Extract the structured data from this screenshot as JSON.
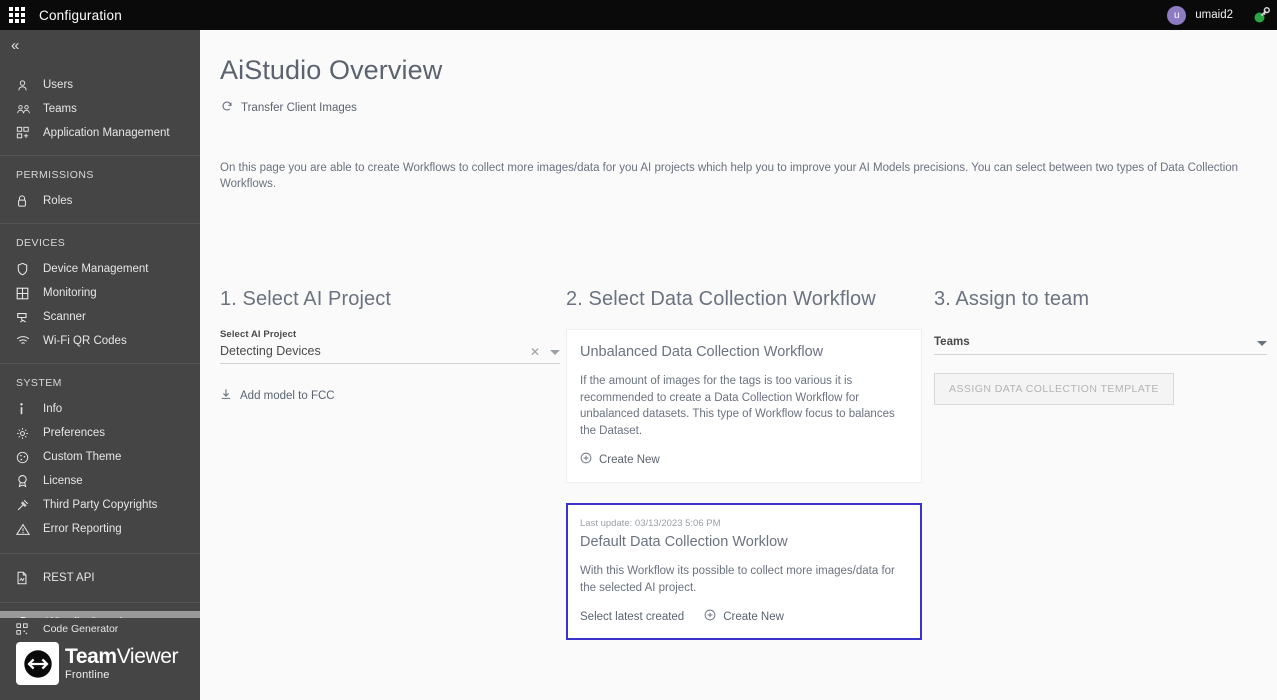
{
  "topbar": {
    "app_grid_icon": "app-grid-icon",
    "title": "Configuration",
    "user": {
      "initial": "u",
      "name": "umaid2"
    },
    "connection_icon": "plug-connected-icon"
  },
  "sidebar": {
    "collapse_icon": "chevron-double-left-icon",
    "groups": [
      {
        "label": "",
        "items": [
          {
            "icon": "user-icon",
            "label": "Users",
            "selected": false
          },
          {
            "icon": "users-group-icon",
            "label": "Teams",
            "selected": false
          },
          {
            "icon": "application-management-icon",
            "label": "Application Management",
            "selected": false
          }
        ]
      },
      {
        "label": "PERMISSIONS",
        "items": [
          {
            "icon": "lock-icon",
            "label": "Roles",
            "selected": false
          }
        ]
      },
      {
        "label": "DEVICES",
        "items": [
          {
            "icon": "shield-icon",
            "label": "Device Management",
            "selected": false
          },
          {
            "icon": "grid-monitor-icon",
            "label": "Monitoring",
            "selected": false
          },
          {
            "icon": "scanner-icon",
            "label": "Scanner",
            "selected": false
          },
          {
            "icon": "wifi-icon",
            "label": "Wi-Fi QR Codes",
            "selected": false
          }
        ]
      },
      {
        "label": "SYSTEM",
        "items": [
          {
            "icon": "info-icon",
            "label": "Info",
            "selected": false
          },
          {
            "icon": "gear-icon",
            "label": "Preferences",
            "selected": false
          },
          {
            "icon": "palette-icon",
            "label": "Custom Theme",
            "selected": false
          },
          {
            "icon": "license-badge-icon",
            "label": "License",
            "selected": false
          },
          {
            "icon": "gavel-icon",
            "label": "Third Party Copyrights",
            "selected": false
          },
          {
            "icon": "warning-triangle-icon",
            "label": "Error Reporting",
            "selected": false
          }
        ]
      },
      {
        "label": "",
        "items": [
          {
            "icon": "api-document-icon",
            "label": "REST API",
            "selected": false
          }
        ]
      },
      {
        "label": "",
        "items": [
          {
            "icon": "aistudio-icon",
            "label": "AiStudio Overview",
            "selected": true
          }
        ]
      }
    ],
    "footer": {
      "code_generator": {
        "icon": "qr-code-icon",
        "label": "Code Generator"
      },
      "brand_bold": "Team",
      "brand_light": "Viewer",
      "brand_sub": "Frontline",
      "brand_mark_icon": "teamviewer-arrows-icon"
    }
  },
  "main": {
    "page_title": "AiStudio Overview",
    "transfer": {
      "icon": "refresh-icon",
      "label": "Transfer Client Images"
    },
    "intro": "On this page you are able to create Workflows to collect more images/data for you AI projects which help you to improve your AI Models precisions. You can select between two types of Data Collection Workflows.",
    "col1": {
      "heading": "1. Select AI Project",
      "field_label": "Select AI Project",
      "field_value": "Detecting Devices",
      "clear_icon": "close-icon",
      "dropdown_icon": "chevron-down-icon",
      "add_model": {
        "icon": "download-icon",
        "label": "Add model to FCC"
      }
    },
    "col2": {
      "heading": "2. Select Data Collection Workflow",
      "cards": [
        {
          "meta": "",
          "title": "Unbalanced Data Collection Workflow",
          "body": "If the amount of images for the tags is too various it is recommended to create a Data Collection Workflow for unbalanced datasets. This type of Workflow focus to balances the Dataset.",
          "select_latest_label": "",
          "create_new_label": "Create New",
          "create_new_icon": "plus-circle-icon",
          "selected": false
        },
        {
          "meta": "Last update: 03/13/2023 5:06 PM",
          "title": "Default Data Collection Worklow",
          "body": "With this Workflow its possible to collect more images/data for the selected AI project.",
          "select_latest_label": "Select latest created",
          "create_new_label": "Create New",
          "create_new_icon": "plus-circle-icon",
          "selected": true
        }
      ]
    },
    "col3": {
      "heading": "3. Assign to team",
      "teams_label": "Teams",
      "teams_dropdown_icon": "chevron-down-icon",
      "assign_button": "ASSIGN DATA COLLECTION TEMPLATE"
    }
  },
  "colors": {
    "topbar_bg": "#0a0a0a",
    "sidebar_bg": "#454545",
    "sidebar_selected": "#9a9a9a",
    "accent_selected_card": "#3b33c9",
    "avatar_bg": "#8e7cc3",
    "status_green": "#27a844",
    "page_bg": "#fafafa"
  }
}
